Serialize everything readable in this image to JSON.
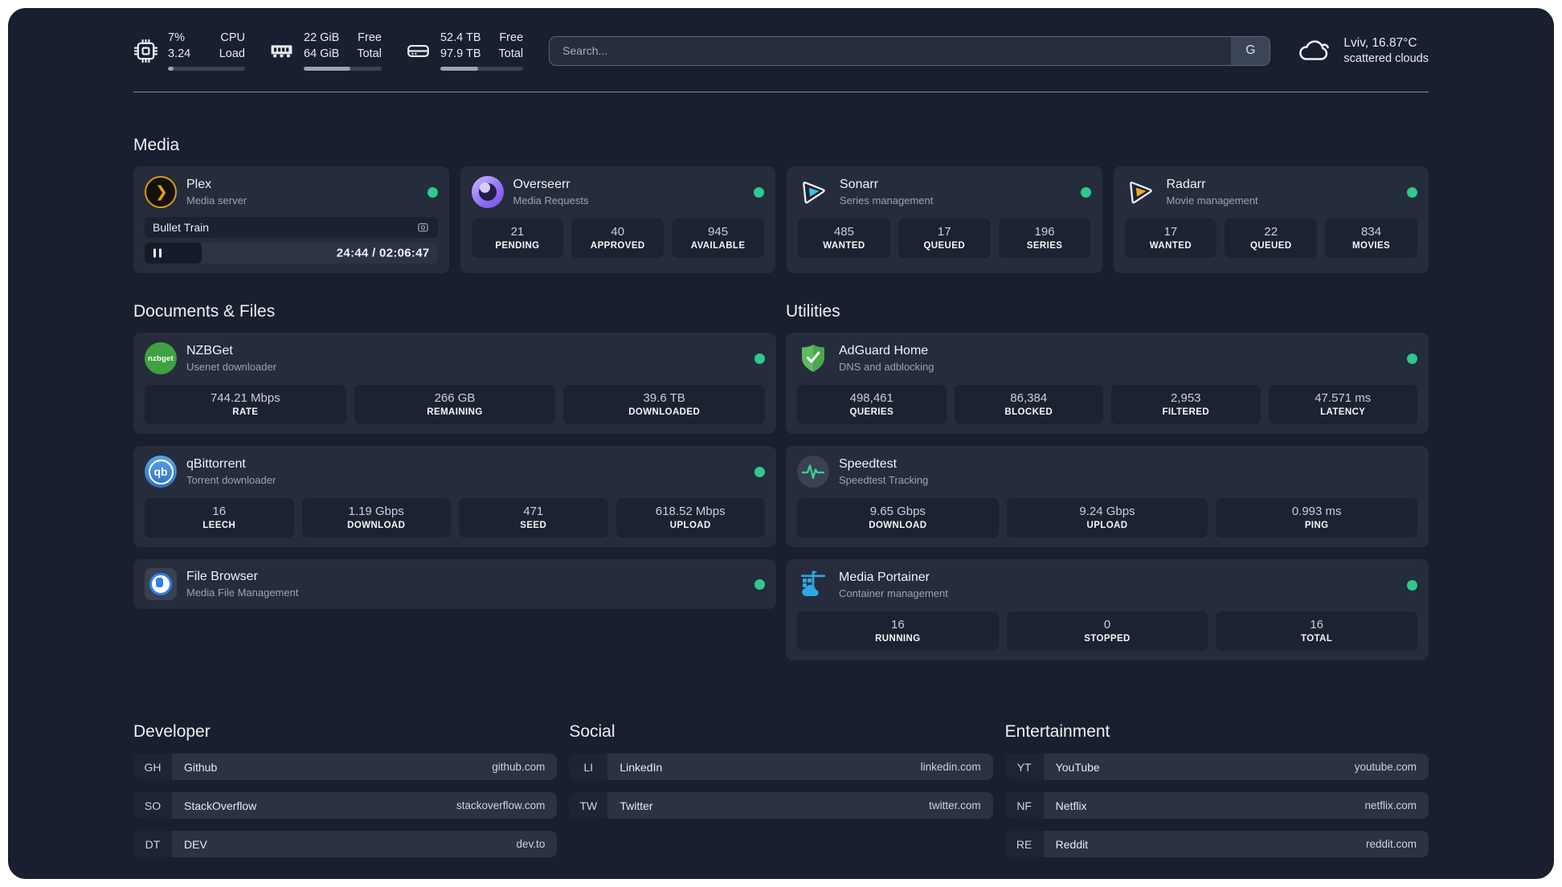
{
  "header": {
    "system_stats": [
      {
        "name": "cpu",
        "value_top": "7%",
        "value_bottom": "3.24",
        "label_top": "CPU",
        "label_bottom": "Load",
        "progress_percent": 7
      },
      {
        "name": "memory",
        "value_top": "22 GiB",
        "value_bottom": "64 GiB",
        "label_top": "Free",
        "label_bottom": "Total",
        "progress_percent": 60
      },
      {
        "name": "storage",
        "value_top": "52.4 TB",
        "value_bottom": "97.9 TB",
        "label_top": "Free",
        "label_bottom": "Total",
        "progress_percent": 46
      }
    ],
    "search": {
      "placeholder": "Search...",
      "engine_button": "G"
    },
    "weather": {
      "location_temp": "Lviv, 16.87°C",
      "condition": "scattered clouds"
    }
  },
  "sections": {
    "media": "Media",
    "documents": "Documents & Files",
    "utilities": "Utilities",
    "developer": "Developer",
    "social": "Social",
    "entertainment": "Entertainment"
  },
  "cards": {
    "plex": {
      "title": "Plex",
      "subtitle": "Media server",
      "now_playing": "Bullet Train",
      "time_display": "24:44 / 02:06:47",
      "progress_percent": 19.5
    },
    "overseerr": {
      "title": "Overseerr",
      "subtitle": "Media Requests",
      "stats": [
        {
          "value": "21",
          "label": "PENDING"
        },
        {
          "value": "40",
          "label": "APPROVED"
        },
        {
          "value": "945",
          "label": "AVAILABLE"
        }
      ]
    },
    "sonarr": {
      "title": "Sonarr",
      "subtitle": "Series management",
      "stats": [
        {
          "value": "485",
          "label": "WANTED"
        },
        {
          "value": "17",
          "label": "QUEUED"
        },
        {
          "value": "196",
          "label": "SERIES"
        }
      ]
    },
    "radarr": {
      "title": "Radarr",
      "subtitle": "Movie management",
      "stats": [
        {
          "value": "17",
          "label": "WANTED"
        },
        {
          "value": "22",
          "label": "QUEUED"
        },
        {
          "value": "834",
          "label": "MOVIES"
        }
      ]
    },
    "nzbget": {
      "title": "NZBGet",
      "subtitle": "Usenet downloader",
      "stats": [
        {
          "value": "744.21 Mbps",
          "label": "RATE"
        },
        {
          "value": "266 GB",
          "label": "REMAINING"
        },
        {
          "value": "39.6 TB",
          "label": "DOWNLOADED"
        }
      ]
    },
    "qbittorrent": {
      "title": "qBittorrent",
      "subtitle": "Torrent downloader",
      "stats": [
        {
          "value": "16",
          "label": "LEECH"
        },
        {
          "value": "1.19 Gbps",
          "label": "DOWNLOAD"
        },
        {
          "value": "471",
          "label": "SEED"
        },
        {
          "value": "618.52 Mbps",
          "label": "UPLOAD"
        }
      ]
    },
    "filebrowser": {
      "title": "File Browser",
      "subtitle": "Media File Management"
    },
    "adguard": {
      "title": "AdGuard Home",
      "subtitle": "DNS and adblocking",
      "stats": [
        {
          "value": "498,461",
          "label": "QUERIES"
        },
        {
          "value": "86,384",
          "label": "BLOCKED"
        },
        {
          "value": "2,953",
          "label": "FILTERED"
        },
        {
          "value": "47.571 ms",
          "label": "LATENCY"
        }
      ]
    },
    "speedtest": {
      "title": "Speedtest",
      "subtitle": "Speedtest Tracking",
      "stats": [
        {
          "value": "9.65 Gbps",
          "label": "DOWNLOAD"
        },
        {
          "value": "9.24 Gbps",
          "label": "UPLOAD"
        },
        {
          "value": "0.993 ms",
          "label": "PING"
        }
      ]
    },
    "portainer": {
      "title": "Media Portainer",
      "subtitle": "Container management",
      "stats": [
        {
          "value": "16",
          "label": "RUNNING"
        },
        {
          "value": "0",
          "label": "STOPPED"
        },
        {
          "value": "16",
          "label": "TOTAL"
        }
      ]
    }
  },
  "links": {
    "developer": [
      {
        "abbr": "GH",
        "name": "Github",
        "url": "github.com"
      },
      {
        "abbr": "SO",
        "name": "StackOverflow",
        "url": "stackoverflow.com"
      },
      {
        "abbr": "DT",
        "name": "DEV",
        "url": "dev.to"
      }
    ],
    "social": [
      {
        "abbr": "LI",
        "name": "LinkedIn",
        "url": "linkedin.com"
      },
      {
        "abbr": "TW",
        "name": "Twitter",
        "url": "twitter.com"
      }
    ],
    "entertainment": [
      {
        "abbr": "YT",
        "name": "YouTube",
        "url": "youtube.com"
      },
      {
        "abbr": "NF",
        "name": "Netflix",
        "url": "netflix.com"
      },
      {
        "abbr": "RE",
        "name": "Reddit",
        "url": "reddit.com"
      }
    ]
  },
  "icons": {
    "plex_glyph": "❯",
    "pause_glyph": "❚❚",
    "google_button": "G"
  },
  "colors": {
    "background": "#191f2e",
    "card": "#252c3b",
    "tile": "#1c2231",
    "status_online": "#2ec98f",
    "plex_amber": "#e5a00d",
    "overseerr_purple": "#8f6bf5",
    "sonarr_blue": "#35c3f1",
    "radarr_yellow": "#f7a823",
    "nzbget_green": "#3fa142",
    "qbittorrent_blue": "#2f88d8",
    "adguard_green": "#5fbb62",
    "speedtest_green": "#34d399",
    "portainer_blue": "#2fa8e1",
    "filebrowser_blue": "#2f80ed"
  }
}
